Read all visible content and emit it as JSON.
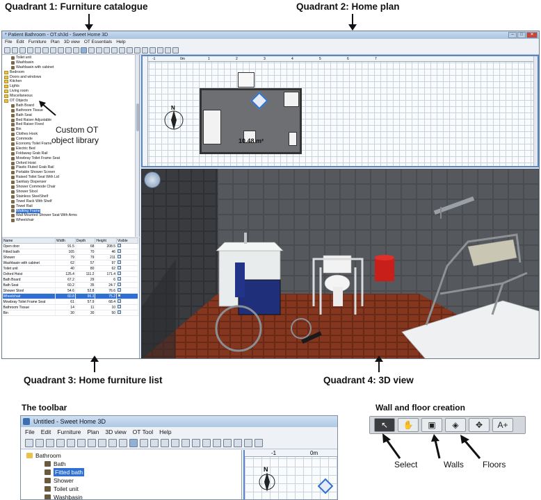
{
  "labels": {
    "q1": "Quadrant 1: Furniture catalogue",
    "q2": "Quadrant 2: Home plan",
    "q3": "Quadrant 3: Home furniture list",
    "q4": "Quadrant 4: 3D view",
    "custom_lib_line1": "Custom OT",
    "custom_lib_line2": "object library",
    "toolbar_heading": "The toolbar",
    "wall_floor_heading": "Wall and floor creation",
    "select": "Select",
    "walls": "Walls",
    "floors": "Floors"
  },
  "app": {
    "title": "* Patient Bathroom - OT.sh3d - Sweet Home 3D",
    "menu": [
      "File",
      "Edit",
      "Furniture",
      "Plan",
      "3D view",
      "OT Essentials",
      "Help"
    ],
    "catalog": [
      {
        "label": "Toilet unit",
        "type": "item"
      },
      {
        "label": "Washbasin",
        "type": "item"
      },
      {
        "label": "Washbasin with cabinet",
        "type": "item"
      },
      {
        "label": "Bedroom",
        "type": "folder"
      },
      {
        "label": "Doors and windows",
        "type": "folder"
      },
      {
        "label": "Kitchen",
        "type": "folder"
      },
      {
        "label": "Lights",
        "type": "folder"
      },
      {
        "label": "Living room",
        "type": "folder"
      },
      {
        "label": "Miscellaneous",
        "type": "folder"
      },
      {
        "label": "OT Objects",
        "type": "folder"
      },
      {
        "label": "Bath Board",
        "type": "item"
      },
      {
        "label": "Bathroom Tissue",
        "type": "item"
      },
      {
        "label": "Bath Seat",
        "type": "item"
      },
      {
        "label": "Bed Raiser Adjustable",
        "type": "item"
      },
      {
        "label": "Bed Raiser Fixed",
        "type": "item"
      },
      {
        "label": "Bin",
        "type": "item"
      },
      {
        "label": "Clothes Hook",
        "type": "item"
      },
      {
        "label": "Commode",
        "type": "item"
      },
      {
        "label": "Economy Toilet Frame",
        "type": "item"
      },
      {
        "label": "Electric Bed",
        "type": "item"
      },
      {
        "label": "Foldaway Grab Rail",
        "type": "item"
      },
      {
        "label": "Mowbray Toilet Frame Seat",
        "type": "item"
      },
      {
        "label": "Oxford Hoist",
        "type": "item"
      },
      {
        "label": "Plastic Fluted Grab Rail",
        "type": "item"
      },
      {
        "label": "Portable Shower Screen",
        "type": "item"
      },
      {
        "label": "Raised Toilet Seat With Lid",
        "type": "item"
      },
      {
        "label": "Sanitary Dispenser",
        "type": "item"
      },
      {
        "label": "Shower Commode Chair",
        "type": "item"
      },
      {
        "label": "Shower Stool",
        "type": "item"
      },
      {
        "label": "Stainless SteelShelf",
        "type": "item"
      },
      {
        "label": "Towel Rack With Shelf",
        "type": "item"
      },
      {
        "label": "Towel Rail",
        "type": "item"
      },
      {
        "label": "Walking Frame",
        "type": "item",
        "selected": true
      },
      {
        "label": "Wall Mounted Shower Seat With Arms",
        "type": "item"
      },
      {
        "label": "Wheelchair",
        "type": "item"
      }
    ],
    "furniture_list": {
      "headers": [
        "Name",
        "Width",
        "Depth",
        "Height",
        "Visible"
      ],
      "rows": [
        [
          "Open door",
          "91.5",
          "68",
          "208.5"
        ],
        [
          "Fitted bath",
          "165",
          "70",
          "46"
        ],
        [
          "Shower",
          "79",
          "79",
          "211"
        ],
        [
          "Washbasin with cabinet",
          "62",
          "57",
          "97"
        ],
        [
          "Toilet unit",
          "40",
          "80",
          "62"
        ],
        [
          "Oxford Hoist",
          "125.4",
          "111.2",
          "171.4"
        ],
        [
          "Bath Board",
          "67.2",
          "29",
          "6"
        ],
        [
          "Bath Seat",
          "60.2",
          "35",
          "24.7"
        ],
        [
          "Shower Stool",
          "54.6",
          "52.8",
          "76.6"
        ],
        [
          "Wheelchair",
          "60.8",
          "96.3",
          "75.2"
        ],
        [
          "Mowbray Toilet Frame Seat",
          "61",
          "57.9",
          "68.4"
        ],
        [
          "Bathroom Tissue",
          "14",
          "11",
          "10"
        ],
        [
          "Bin",
          "30",
          "30",
          "50"
        ]
      ],
      "selected_row": 9
    },
    "plan": {
      "ruler_marks": [
        "-1",
        "0m",
        "1",
        "2",
        "3",
        "4",
        "5",
        "6",
        "7"
      ],
      "room_area": "10.48 m²"
    }
  },
  "zoom_window": {
    "title": "Untitled - Sweet Home 3D",
    "menu": [
      "File",
      "Edit",
      "Furniture",
      "Plan",
      "3D view",
      "OT Tool",
      "Help"
    ],
    "tree": [
      {
        "label": "Bathroom",
        "type": "folder"
      },
      {
        "label": "Bath",
        "type": "item"
      },
      {
        "label": "Fitted bath",
        "type": "item",
        "selected": true
      },
      {
        "label": "Shower",
        "type": "item"
      },
      {
        "label": "Toilet unit",
        "type": "item"
      },
      {
        "label": "Washbasin",
        "type": "item"
      }
    ],
    "ruler_marks": [
      "-1",
      "0m"
    ]
  },
  "wall_floor_bar": {
    "buttons": [
      {
        "name": "select-tool",
        "glyph": "↖"
      },
      {
        "name": "pan-tool",
        "glyph": "✋"
      },
      {
        "name": "walls-tool",
        "glyph": "▣"
      },
      {
        "name": "floors-tool",
        "glyph": "◈"
      },
      {
        "name": "dimension-tool",
        "glyph": "✥"
      },
      {
        "name": "text-tool",
        "glyph": "A+"
      }
    ]
  }
}
